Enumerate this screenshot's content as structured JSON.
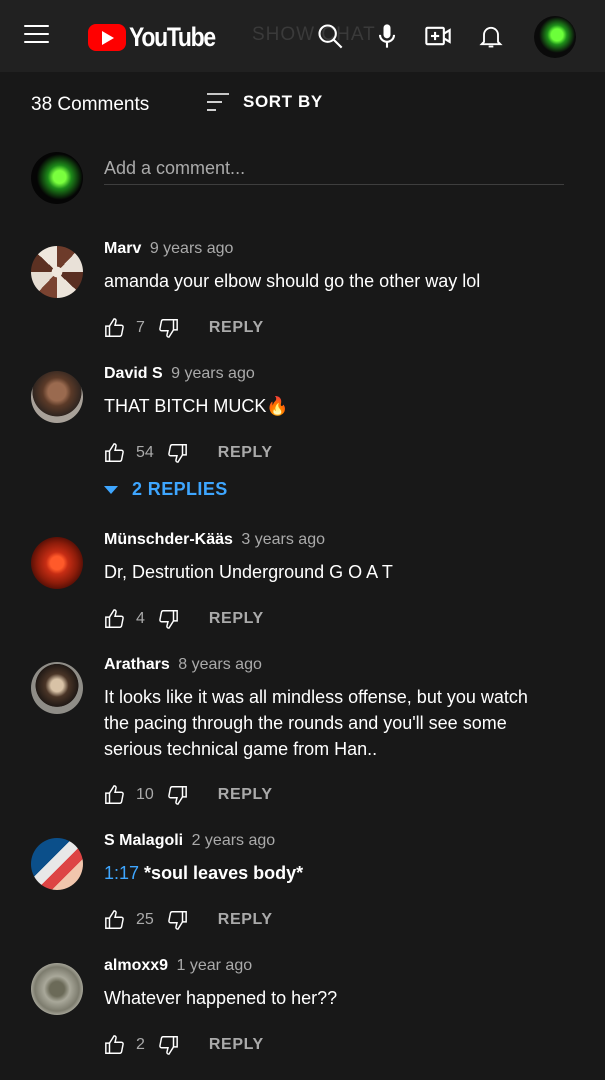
{
  "header": {
    "logo_text": "YouTube",
    "ghost_text": "SHOW CHAT",
    "icons": [
      "menu-icon",
      "search-icon",
      "microphone-icon",
      "create-video-icon",
      "notifications-bell-icon",
      "account-avatar"
    ]
  },
  "comments_section": {
    "count_label": "38 Comments",
    "sort_label": "SORT BY",
    "add_placeholder": "Add a comment...",
    "reply_label": "REPLY",
    "items": [
      {
        "author": "Marv",
        "time": "9 years ago",
        "timestamp_link": "",
        "text": "amanda your elbow should go the other way lol",
        "likes": "7",
        "replies": ""
      },
      {
        "author": "David S",
        "time": "9 years ago",
        "timestamp_link": "",
        "text": "THAT BITCH MUCK🔥",
        "likes": "54",
        "replies": "2 REPLIES"
      },
      {
        "author": "Münschder-Kääs",
        "time": "3 years ago",
        "timestamp_link": "",
        "text": "Dr, Destrution Underground G O A T",
        "likes": "4",
        "replies": ""
      },
      {
        "author": "Arathars",
        "time": "8 years ago",
        "timestamp_link": "",
        "text": "It looks like it was all mindless offense, but you watch the pacing through the rounds and you'll see some serious technical game from Han..",
        "likes": "10",
        "replies": ""
      },
      {
        "author": "S Malagoli",
        "time": "2 years ago",
        "timestamp_link": "1:17",
        "text": " *soul leaves body*",
        "likes": "25",
        "replies": ""
      },
      {
        "author": "almoxx9",
        "time": "1 year ago",
        "timestamp_link": "",
        "text": "Whatever happened to her??",
        "likes": "2",
        "replies": ""
      }
    ]
  },
  "colors": {
    "background": "#181818",
    "topbar": "#212121",
    "link_blue": "#3ea6ff",
    "secondary_text": "#aaaaaa",
    "brand_red": "#ff0000"
  }
}
